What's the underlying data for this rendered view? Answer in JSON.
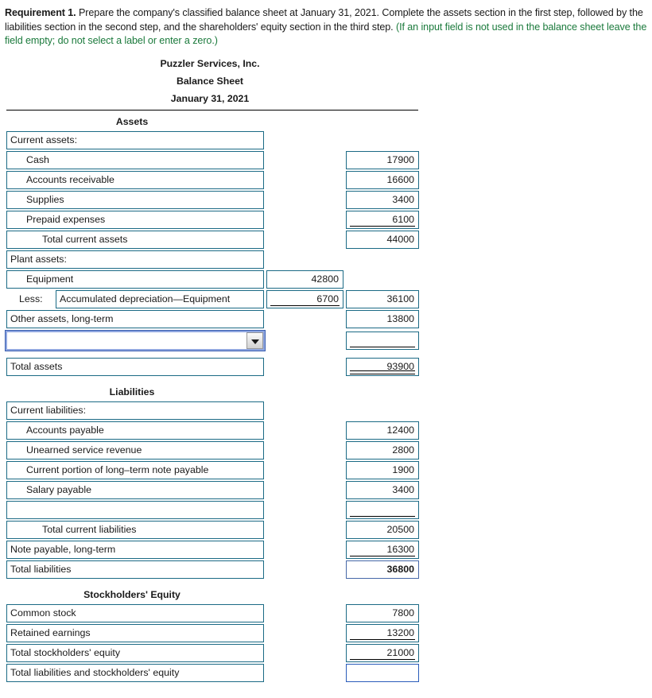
{
  "requirement": {
    "label": "Requirement 1.",
    "text": " Prepare the company's classified balance sheet at January 31, 2021. Complete the assets section in the first step, followed by the liabilities section in the second step, and the shareholders' equity section in the third step. ",
    "note": "(If an input field is not used in the balance sheet leave the field empty; do not select a label or enter a zero.)",
    "note_color": "#1b7a3c"
  },
  "sheet": {
    "company": "Puzzler Services, Inc.",
    "statement": "Balance Sheet",
    "date": "January 31, 2021",
    "border_color": "#1b6a85",
    "focus_color": "#2a5cba",
    "sections": [
      {
        "heading": "Assets"
      },
      {
        "heading": "Liabilities"
      },
      {
        "heading": "Stockholders' Equity"
      }
    ],
    "assets_rows": [
      {
        "label": "Current assets:",
        "indent": 0,
        "value": "",
        "rule": "none"
      },
      {
        "label": "Cash",
        "indent": 1,
        "value": "17900",
        "rule": "none"
      },
      {
        "label": "Accounts receivable",
        "indent": 1,
        "value": "16600",
        "rule": "none"
      },
      {
        "label": "Supplies",
        "indent": 1,
        "value": "3400",
        "rule": "none"
      },
      {
        "label": "Prepaid expenses",
        "indent": 1,
        "value": "6100",
        "rule": "single"
      },
      {
        "label": "Total current assets",
        "indent": 2,
        "value": "44000",
        "rule": "none"
      },
      {
        "label": "Plant assets:",
        "indent": 0,
        "value": "",
        "rule": "none"
      }
    ],
    "equipment_row": {
      "label": "Equipment",
      "indent": 1,
      "mid": "42800"
    },
    "less_row": {
      "prefix": "Less:",
      "label": "Accumulated depreciation—Equipment",
      "mid": "6700",
      "mid_rule": "single",
      "value": "36100"
    },
    "other_assets_row": {
      "label": "Other assets, long-term",
      "indent": 0,
      "value": "13800"
    },
    "select_row": {
      "selected": "",
      "value": "",
      "rule": "single",
      "caret": "chevron-down-icon"
    },
    "total_assets_row": {
      "label": "Total assets",
      "indent": 0,
      "value": "93900",
      "rule": "double"
    },
    "liabilities_rows": [
      {
        "label": "Current liabilities:",
        "indent": 0,
        "value": "",
        "rule": "none"
      },
      {
        "label": "Accounts payable",
        "indent": 1,
        "value": "12400",
        "rule": "none"
      },
      {
        "label": "Unearned service revenue",
        "indent": 1,
        "value": "2800",
        "rule": "none"
      },
      {
        "label": "Current portion of long–term note payable",
        "indent": 1,
        "value": "1900",
        "rule": "none"
      },
      {
        "label": "Salary payable",
        "indent": 1,
        "value": "3400",
        "rule": "none"
      },
      {
        "label": "",
        "indent": 1,
        "value": "",
        "rule": "single"
      },
      {
        "label": "Total current liabilities",
        "indent": 2,
        "value": "20500",
        "rule": "none"
      },
      {
        "label": "Note payable, long-term",
        "indent": 0,
        "value": "16300",
        "rule": "single"
      }
    ],
    "total_liabilities_row": {
      "label": "Total liabilities",
      "indent": 0,
      "value": "36800",
      "rule": "none",
      "state": "focused"
    },
    "equity_rows": [
      {
        "label": "Common stock",
        "indent": 0,
        "value": "7800",
        "rule": "none"
      },
      {
        "label": "Retained earnings",
        "indent": 0,
        "value": "13200",
        "rule": "single"
      },
      {
        "label": "Total stockholders' equity",
        "indent": 0,
        "value": "21000",
        "rule": "single"
      },
      {
        "label": "Total liabilities and stockholders' equity",
        "indent": 0,
        "value": "",
        "rule": "none",
        "state": "active"
      }
    ]
  }
}
